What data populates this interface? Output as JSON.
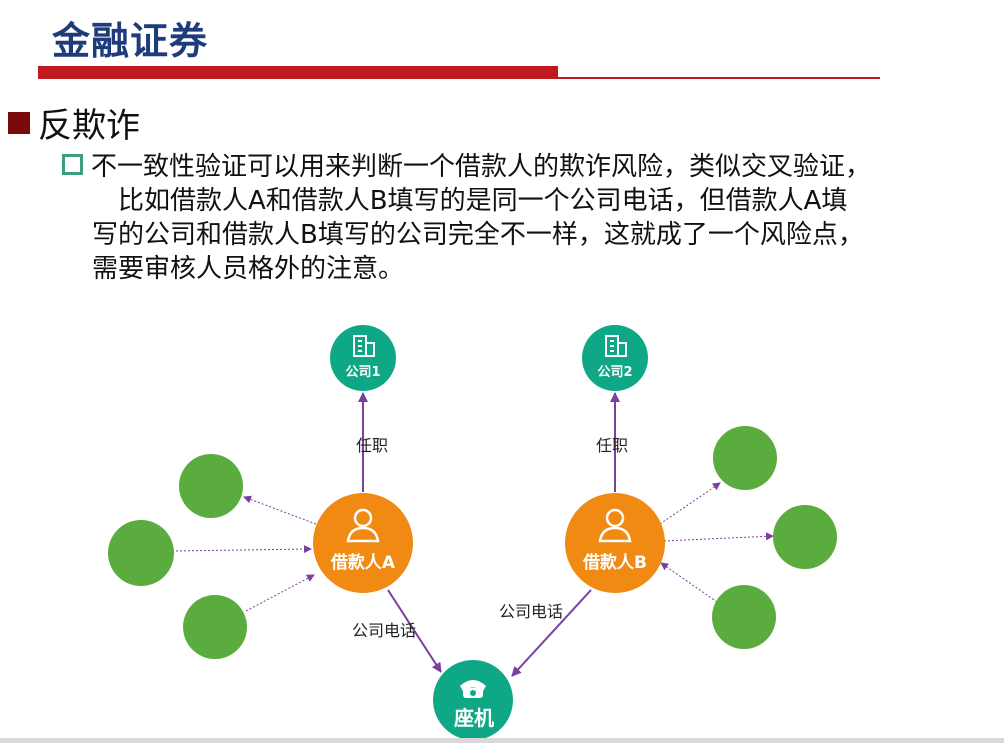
{
  "header": {
    "title": "金融证券"
  },
  "section": {
    "heading": "反欺诈"
  },
  "paragraph": {
    "line1": "不一致性验证可以用来判断一个借款人的欺诈风险，类似交叉验证，",
    "line2": "比如借款人A和借款人B填写的是同一个公司电话，但借款人A填",
    "line3": "写的公司和借款人B填写的公司完全不一样，这就成了一个风险点，",
    "line4": "需要审核人员格外的注意。"
  },
  "diagram": {
    "nodes": {
      "company1": "公司1",
      "company2": "公司2",
      "borrowerA": "借款人A",
      "borrowerB": "借款人B",
      "landline": "座机"
    },
    "edges": {
      "a_job": "任职",
      "b_job": "任职",
      "a_phone": "公司电话",
      "b_phone": "公司电话"
    },
    "colors": {
      "teal": "#0fa886",
      "orange": "#f08a12",
      "green": "#5aac3e",
      "edge": "#7a3fa0"
    }
  }
}
